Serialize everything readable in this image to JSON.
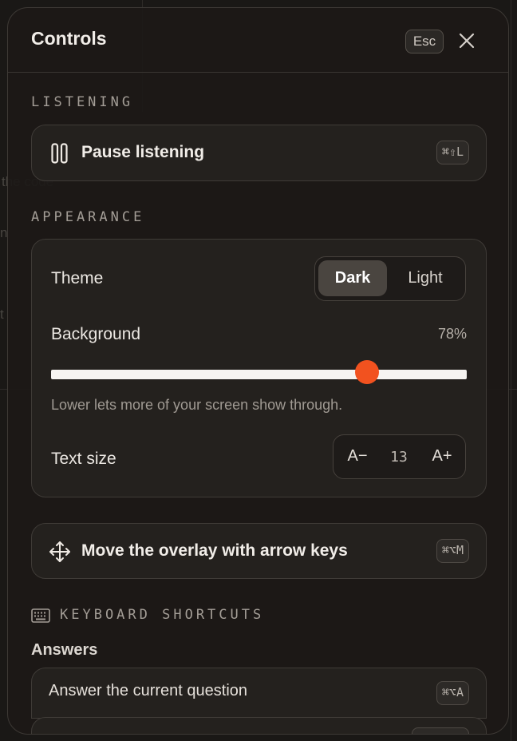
{
  "header": {
    "title": "Controls",
    "esc_key": "Esc",
    "close_icon": "close-icon"
  },
  "listening": {
    "section_label": "LISTENING",
    "pause_label": "Pause listening",
    "pause_icon": "pause-icon",
    "pause_shortcut": "⌘⇧L"
  },
  "appearance": {
    "section_label": "APPEARANCE",
    "theme_label": "Theme",
    "theme_options": [
      "Dark",
      "Light"
    ],
    "theme_selected": "Dark",
    "background_label": "Background",
    "background_value_text": "78%",
    "background_value": 0.76,
    "background_hint": "Lower lets more of your screen show through.",
    "text_size_label": "Text size",
    "text_size_decrease": "A−",
    "text_size_value": "13",
    "text_size_increase": "A+",
    "accent_color": "#f2521f"
  },
  "move": {
    "label": "Move the overlay with arrow keys",
    "icon": "move-arrows-icon",
    "shortcut": "⌘⌥M"
  },
  "shortcuts": {
    "section_label": "KEYBOARD SHORTCUTS",
    "section_icon": "keyboard-icon",
    "group_title": "Answers",
    "items": [
      {
        "label": "Answer the current question",
        "shortcut": "⌘⌥A"
      }
    ]
  }
}
